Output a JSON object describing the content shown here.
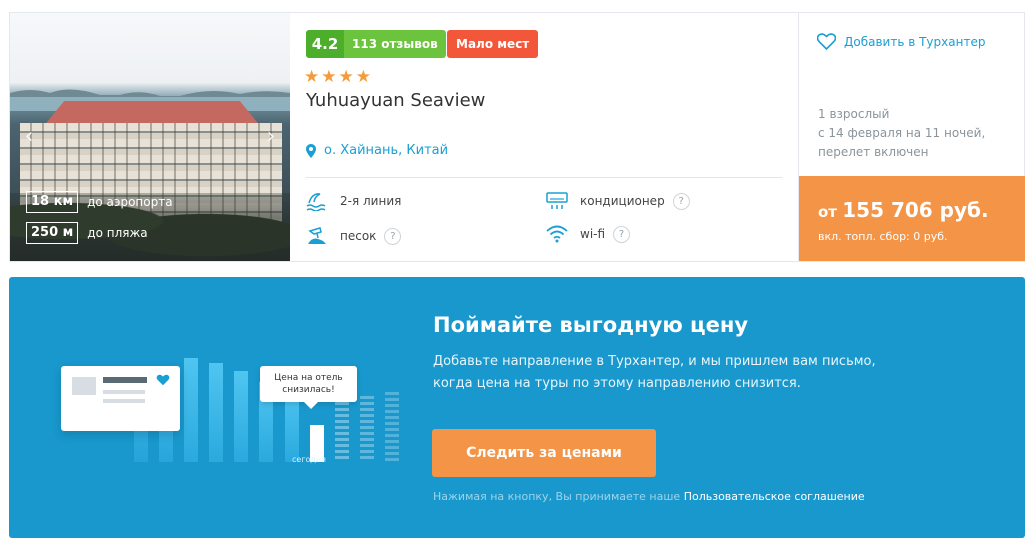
{
  "hotel": {
    "rating": "4.2",
    "reviews": "113 отзывов",
    "availability_badge": "Мало мест",
    "stars": "★★★★",
    "star_count": 4,
    "name": "Yuhuayuan Seaview",
    "location": "о. Хайнань, Китай",
    "distances": [
      {
        "value": "18 км",
        "label": "до аэропорта"
      },
      {
        "value": "250 м",
        "label": "до пляжа"
      }
    ],
    "features": [
      {
        "icon": "beach-line-icon",
        "label": "2-я линия",
        "has_help": false
      },
      {
        "icon": "air-conditioner-icon",
        "label": "кондиционер",
        "has_help": true
      },
      {
        "icon": "sand-icon",
        "label": "песок",
        "has_help": true
      },
      {
        "icon": "wifi-icon",
        "label": "wi-fi",
        "has_help": true
      }
    ],
    "help_mark": "?"
  },
  "side": {
    "favorite_label": "Добавить в Турхантер",
    "tour_lines": [
      "1 взрослый",
      "с 14 февраля на 11 ночей,",
      "перелет включен"
    ],
    "price_prefix": "от",
    "price_value": "155 706 руб.",
    "fee": "вкл. топл. сбор: 0 руб."
  },
  "banner": {
    "title": "Поймайте выгодную цену",
    "text_line1": "Добавьте направление в Турхантер, и мы пришлем вам письмо,",
    "text_line2": "когда цена на туры по этому направлению снизится.",
    "cta": "Следить за ценами",
    "agree_text": "Нажимая на кнопку, Вы принимаете наше",
    "agree_link": "Пользовательское соглашение",
    "bubble_line1": "Цена на отель",
    "bubble_line2": "снизилась!",
    "today_label": "сегодня"
  },
  "colors": {
    "accent_blue": "#1a9fd4",
    "orange": "#f39447",
    "rating_green": "#4dae2c",
    "badge_red": "#f3573a",
    "banner_blue": "#1898cd"
  }
}
